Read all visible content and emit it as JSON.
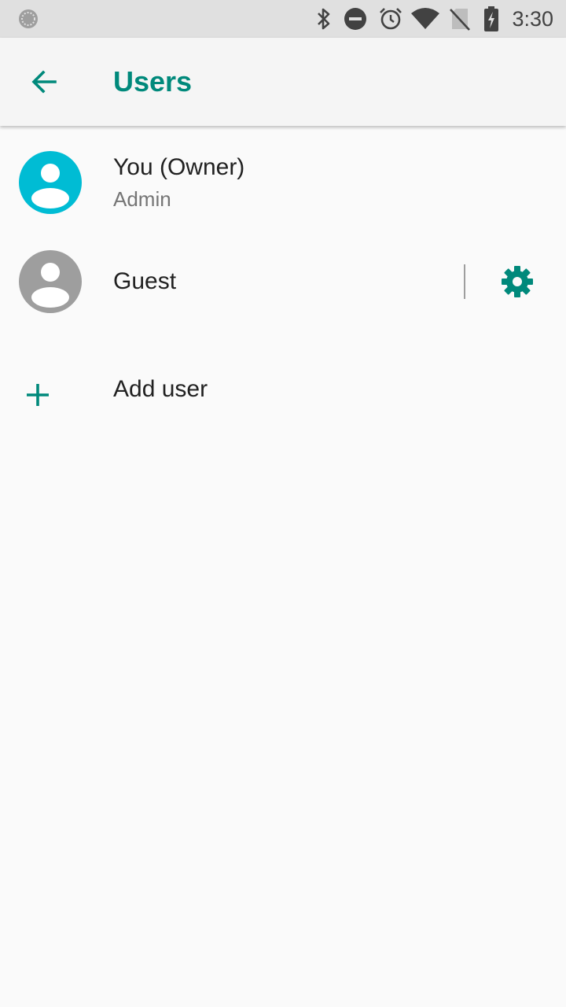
{
  "status_bar": {
    "time": "3:30",
    "icons": [
      "sync-icon",
      "bluetooth-icon",
      "do-not-disturb-icon",
      "alarm-icon",
      "wifi-icon",
      "no-sim-icon",
      "battery-charging-icon"
    ]
  },
  "app_bar": {
    "title": "Users",
    "back_icon": "arrow-back-icon"
  },
  "users": [
    {
      "name": "You (Owner)",
      "role": "Admin",
      "avatar_color": "#00bcd4"
    },
    {
      "name": "Guest",
      "avatar_color": "#9e9e9e",
      "settings_icon": "gear-icon"
    }
  ],
  "add_user": {
    "label": "Add user",
    "icon": "plus-icon"
  },
  "colors": {
    "accent": "#00897b",
    "status_bar_bg": "#e0e0e0",
    "app_bar_bg": "#f5f5f5",
    "background": "#fafafa"
  }
}
